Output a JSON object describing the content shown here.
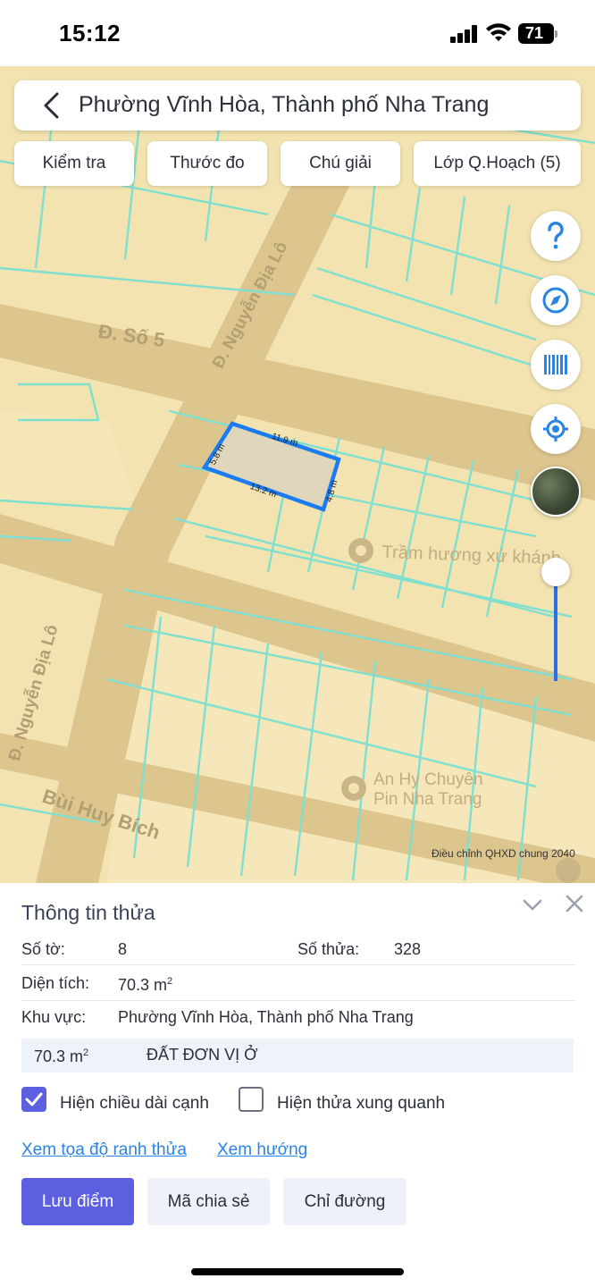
{
  "status_bar": {
    "time": "15:12",
    "battery": "71"
  },
  "header": {
    "title": "Phường Vĩnh Hòa, Thành phố Nha Trang",
    "back_icon": "chevron-left-icon"
  },
  "toolbar": {
    "chips": [
      "Kiểm tra",
      "Thước đo",
      "Chú giải",
      "Lớp Q.Hoạch (5)"
    ]
  },
  "map": {
    "road_labels": [
      "Đ. Số 5",
      "Đ. Nguyễn Địa Lô",
      "Đ. Nguyễn Địa Lô",
      "Bùi Huy Bích"
    ],
    "places": [
      "Trầm hương xứ khánh",
      "An Hy Chuyên",
      "Pin Nha Trang"
    ],
    "parcel_edges": [
      "11.9 m",
      "4.8 m",
      "13.2 m",
      "5.8 m"
    ],
    "credit": "Điều chỉnh QHXD chung 2040",
    "colors": {
      "land": "#f3e3b0",
      "road": "#ddc58e",
      "parcel_lines": "#7fe0d0",
      "selection": "#1a7cf0",
      "slider": "#2f6fe4"
    },
    "side_buttons": [
      "help-icon",
      "compass-icon",
      "barcode-icon",
      "locate-icon",
      "satellite-icon"
    ]
  },
  "panel": {
    "title": "Thông tin thửa",
    "rows": {
      "so_to_label": "Số tờ:",
      "so_to_value": "8",
      "so_thua_label": "Số thửa:",
      "so_thua_value": "328",
      "dien_tich_label": "Diện tích:",
      "dien_tich_value": "70.3 m",
      "dien_tich_unit_sup": "2",
      "khu_vuc_label": "Khu vực:",
      "khu_vuc_value": "Phường Vĩnh Hòa, Thành phố Nha Trang"
    },
    "zone": {
      "area": "70.3 m",
      "area_sup": "2",
      "name": "ĐẤT ĐƠN VỊ Ở"
    },
    "checkboxes": {
      "show_edges_label": "Hiện chiều dài cạnh",
      "show_edges_checked": true,
      "show_neighbors_label": "Hiện thửa xung quanh",
      "show_neighbors_checked": false
    },
    "links": {
      "coords": "Xem tọa độ ranh thửa",
      "direction": "Xem hướng"
    },
    "buttons": {
      "save": "Lưu điểm",
      "share": "Mã chia sẻ",
      "route": "Chỉ đường"
    },
    "accent": "#5b5fe0",
    "link_color": "#2a84e3"
  }
}
